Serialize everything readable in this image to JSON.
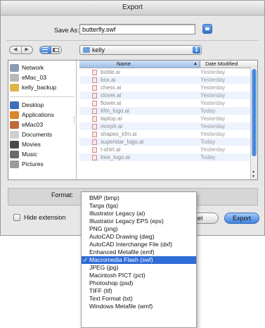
{
  "window": {
    "title": "Export"
  },
  "save_as": {
    "label": "Save As:",
    "value": "butterfly.swf"
  },
  "nav": {
    "back": "◀",
    "forward": "▶"
  },
  "folder_popup": {
    "value": "kelly"
  },
  "sidebar": {
    "devices": [
      {
        "label": "Network",
        "icon": "network-icon",
        "color": "#8a9bb3"
      },
      {
        "label": "eMac_03",
        "icon": "drive-icon",
        "color": "#b8b8b8"
      },
      {
        "label": "kelly_backup",
        "icon": "external-drive-icon",
        "color": "#e0b44a"
      }
    ],
    "places": [
      {
        "label": "Desktop",
        "icon": "desktop-icon",
        "color": "#3e6fb8"
      },
      {
        "label": "Applications",
        "icon": "applications-icon",
        "color": "#d9862b"
      },
      {
        "label": "eMac03",
        "icon": "home-icon",
        "color": "#c06a3a"
      },
      {
        "label": "Documents",
        "icon": "documents-icon",
        "color": "#cfcfcf"
      },
      {
        "label": "Movies",
        "icon": "movies-icon",
        "color": "#4a4a4a"
      },
      {
        "label": "Music",
        "icon": "music-icon",
        "color": "#6b6b6b"
      },
      {
        "label": "Pictures",
        "icon": "pictures-icon",
        "color": "#9a9a9a"
      }
    ]
  },
  "file_list": {
    "columns": {
      "name": "Name",
      "date": "Date Modified",
      "sort_indicator": "▲"
    },
    "rows": [
      {
        "name": "bottle.ai",
        "date": "Yesterday"
      },
      {
        "name": "box.ai",
        "date": "Yesterday"
      },
      {
        "name": "chess.ai",
        "date": "Yesterday"
      },
      {
        "name": "clover.ai",
        "date": "Yesterday"
      },
      {
        "name": "flower.ai",
        "date": "Yesterday"
      },
      {
        "name": "kfm_logo.ai",
        "date": "Today"
      },
      {
        "name": "laptop.ai",
        "date": "Yesterday"
      },
      {
        "name": "morph.ai",
        "date": "Yesterday"
      },
      {
        "name": "shapes_kfm.ai",
        "date": "Yesterday"
      },
      {
        "name": "superstar_logo.ai",
        "date": "Today"
      },
      {
        "name": "t-shirt.ai",
        "date": "Yesterday"
      },
      {
        "name": "tree_logo.ai",
        "date": "Today"
      }
    ]
  },
  "format": {
    "label": "Format:",
    "options": [
      "BMP (bmp)",
      "Targa (tga)",
      "Illustrator Legacy (ai)",
      "Illustrator Legacy EPS (eps)",
      "PNG (png)",
      "AutoCAD Drawing (dwg)",
      "AutoCAD Interchange File (dxf)",
      "Enhanced Metafile (emf)",
      "Macromedia Flash (swf)",
      "JPEG (jpg)",
      "Macintosh PICT (pct)",
      "Photoshop (psd)",
      "TIFF (tif)",
      "Text Format (txt)",
      "Windows Metafile (wmf)"
    ],
    "selected": "Macromedia Flash (swf)",
    "check_mark": "✓"
  },
  "hide_extension": {
    "label": "Hide extension"
  },
  "buttons": {
    "cancel": "ncel",
    "export": "Export"
  },
  "colors": {
    "accent": "#2f6dd7",
    "selection": "#2f6dd7"
  }
}
